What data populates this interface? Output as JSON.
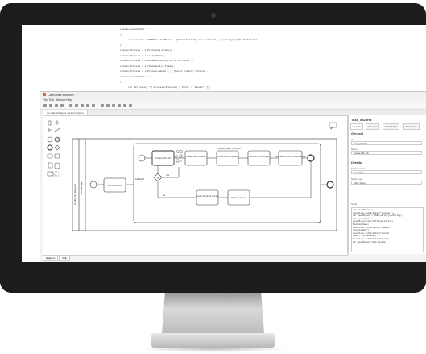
{
  "window": {
    "title": "Camunda Modeler"
  },
  "menu": [
    "File",
    "Edit",
    "Window",
    "Help"
  ],
  "tabs": [
    {
      "label": "dc-node-configure-via-bpmn.bpmn"
    }
  ],
  "code": {
    "lines": [
      {
        "n": "",
        "text": "column.commitChar = '"
      },
      {
        "n": "",
        "text": "{"
      },
      {
        "n": "",
        "text": "var builder = BPMN(buttonMode) — {\"ActivTitle\"}.on.( Entered(..) ).trigger(\"UpdateTable\")..."
      },
      {
        "n": "",
        "text": "};"
      },
      {
        "n": "",
        "text": "column.Process = s.Process(s.Frame);"
      },
      {
        "n": "",
        "text": "column.Process = s.scriptPart);"
      },
      {
        "n": "",
        "text": "column.Process = s.documentTable('16:32 PM Local');"
      },
      {
        "n": "",
        "text": "column.Process = s.rDocument(s.frame);"
      },
      {
        "n": "",
        "text": "column.Process = s.Process.Head(...) (Local client) Entered..."
      },
      {
        "n": "",
        "text": "column.commitChar = '"
      },
      {
        "n": "",
        "text": "{"
      },
      {
        "n": "",
        "text": "var Ok(.hold, \"\").Process(Process) ; fetch : 'Render' ]);"
      }
    ]
  },
  "diagram": {
    "pool_label": "Config VM Request",
    "lane_label": "VM Manager",
    "subprocess_label": "Process each VM item",
    "tasks": [
      {
        "id": "t1",
        "label": "Get VM items"
      },
      {
        "id": "t2",
        "label": "Create VM Job"
      },
      {
        "id": "t3",
        "label": "Create VM in vCenter"
      },
      {
        "id": "t4",
        "label": "Create VM in VSphere"
      },
      {
        "id": "t5",
        "label": "Connect VM to Cloud"
      },
      {
        "id": "t6",
        "label": "Associate vCenter & Cloud Machine"
      },
      {
        "id": "t7",
        "label": "Create VM job for vCenter"
      },
      {
        "id": "t8",
        "label": "Push to vCenter"
      }
    ],
    "gateway_labels": {
      "exclusive": "Fallback?",
      "yes": "Yes",
      "no": "No"
    },
    "end_event_label": "End"
  },
  "properties": {
    "element_id": "Task_0a2prtd",
    "tabs": [
      "General",
      "Listeners",
      "Input/Output",
      "Extensions"
    ],
    "sections": {
      "general": "General",
      "details": "Details"
    },
    "fields": [
      {
        "label": "Id",
        "value": "Task_0a2prtd"
      },
      {
        "label": "Name",
        "value": "Create VM Job"
      },
      {
        "label": "Script Format",
        "value": "javascript"
      },
      {
        "label": "Script Type",
        "value": "Inline Script"
      }
    ],
    "script_label": "Script",
    "script_lines": [
      "var jsonString = ",
      "execution.getVariable(\"jsonSer\");",
      "var jsonObject = JSON.parse(jsonString);",
      "var systemName =",
      "jsonObject.item.Settings.Virtual",
      "Machine.Name;",
      "execution.setVariable(\"vmName\",",
      "\"SystemName\");",
      "execution.setVariable(\"system",
      "Name\", systemName);",
      "execution.setVariable(\"system",
      "Id\",jsonObject.item.System"
    ]
  },
  "bottom_tabs": [
    "Diagram",
    "XML"
  ]
}
